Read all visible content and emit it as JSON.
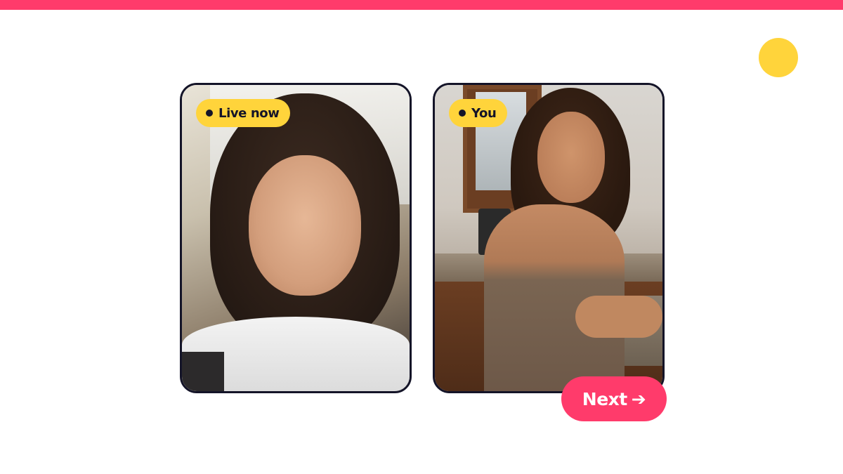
{
  "colors": {
    "accent": "#ff3b6b",
    "badge": "#ffd43b",
    "dark": "#141428",
    "background": "#ffffff"
  },
  "left_tile": {
    "badge_label": "Live now",
    "badge_icon": "dot-icon",
    "image": "video-feed-remote-person"
  },
  "right_tile": {
    "badge_label": "You",
    "badge_icon": "dot-icon",
    "image": "video-feed-self"
  },
  "next_button": {
    "label": "Next",
    "icon": "arrow-right-icon",
    "icon_glyph": "➔"
  }
}
